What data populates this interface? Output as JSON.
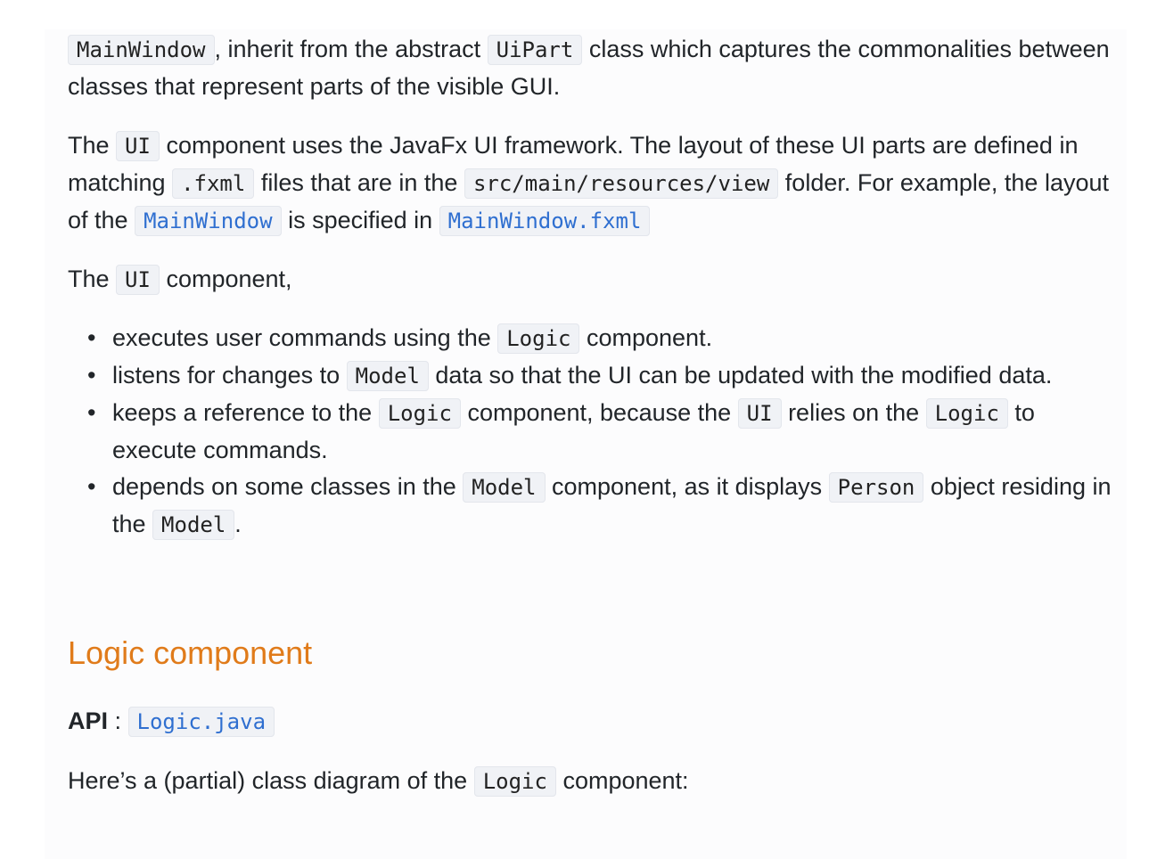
{
  "para1": {
    "code_mainwindow": "MainWindow",
    "text_a": ", inherit from the abstract ",
    "code_uipart": "UiPart",
    "text_b": " class which captures the commonalities between classes that represent parts of the visible GUI."
  },
  "para2": {
    "text_a": "The ",
    "code_ui": "UI",
    "text_b": " component uses the JavaFx UI framework. The layout of these UI parts are defined in matching ",
    "code_fxml": ".fxml",
    "text_c": " files that are in the ",
    "code_path": "src/main/resources/view",
    "text_d": " folder. For example, the layout of the ",
    "link_mainwindow": "MainWindow",
    "text_e": " is specified in ",
    "link_mainwindow_fxml": "MainWindow.fxml"
  },
  "para3": {
    "text_a": "The ",
    "code_ui": "UI",
    "text_b": " component,"
  },
  "list": {
    "bullet": "•",
    "item1": {
      "text_a": "executes user commands using the ",
      "code_logic": "Logic",
      "text_b": " component."
    },
    "item2": {
      "text_a": "listens for changes to ",
      "code_model": "Model",
      "text_b": " data so that the UI can be updated with the modified data."
    },
    "item3": {
      "text_a": "keeps a reference to the ",
      "code_logic": "Logic",
      "text_b": " component, because the ",
      "code_ui": "UI",
      "text_c": " relies on the ",
      "code_logic2": "Logic",
      "text_d": " to execute commands."
    },
    "item4": {
      "text_a": "depends on some classes in the ",
      "code_model": "Model",
      "text_b": " component, as it displays ",
      "code_person": "Person",
      "text_c": " object residing in the ",
      "code_model2": "Model",
      "text_d": "."
    }
  },
  "heading": "Logic component",
  "api": {
    "label": "API",
    "sep": " : ",
    "link": "Logic.java"
  },
  "para5": {
    "text_a": "Here’s a (partial) class diagram of the ",
    "code_logic": "Logic",
    "text_b": " component:"
  },
  "colors": {
    "heading": "#e07b1a",
    "link": "#2f6fd0",
    "code_bg": "#f0f2f6"
  }
}
